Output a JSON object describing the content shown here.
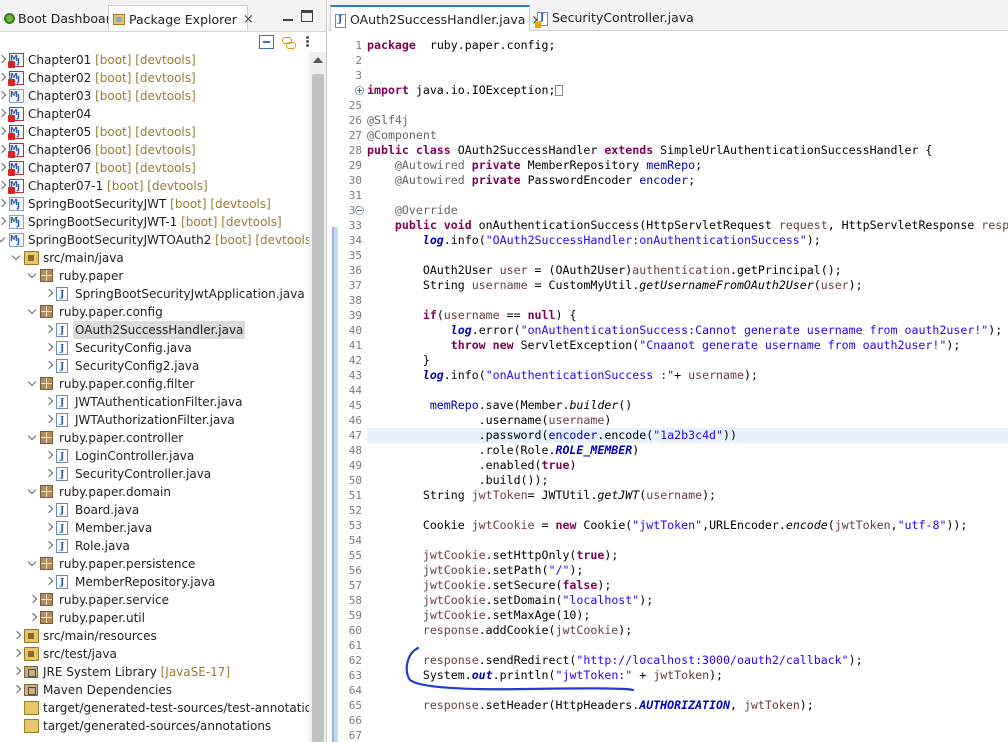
{
  "left_tabs": {
    "boot_dashboard": "Boot Dashboard",
    "package_explorer": "Package Explorer",
    "close": "×"
  },
  "tree": [
    {
      "level": 0,
      "twisty": "closed",
      "icon": "proj",
      "error": true,
      "name": "Chapter01",
      "tag": "[boot] [devtools]"
    },
    {
      "level": 0,
      "twisty": "closed",
      "icon": "proj",
      "error": true,
      "name": "Chapter02",
      "tag": "[boot] [devtools]"
    },
    {
      "level": 0,
      "twisty": "closed",
      "icon": "proj",
      "error": false,
      "name": "Chapter03",
      "tag": "[boot] [devtools]"
    },
    {
      "level": 0,
      "twisty": "closed",
      "icon": "proj",
      "error": true,
      "name": "Chapter04",
      "tag": ""
    },
    {
      "level": 0,
      "twisty": "closed",
      "icon": "proj",
      "error": true,
      "name": "Chapter05",
      "tag": "[boot] [devtools]"
    },
    {
      "level": 0,
      "twisty": "closed",
      "icon": "proj",
      "error": true,
      "name": "Chapter06",
      "tag": "[boot] [devtools]"
    },
    {
      "level": 0,
      "twisty": "closed",
      "icon": "proj",
      "error": true,
      "name": "Chapter07",
      "tag": "[boot] [devtools]"
    },
    {
      "level": 0,
      "twisty": "closed",
      "icon": "proj",
      "error": true,
      "name": "Chapter07-1",
      "tag": "[boot] [devtools]"
    },
    {
      "level": 0,
      "twisty": "closed",
      "icon": "proj",
      "error": false,
      "name": "SpringBootSecurityJWT",
      "tag": "[boot] [devtools]"
    },
    {
      "level": 0,
      "twisty": "closed",
      "icon": "proj",
      "error": false,
      "name": "SpringBootSecurityJWT-1",
      "tag": "[boot] [devtools]"
    },
    {
      "level": 0,
      "twisty": "open",
      "icon": "proj",
      "error": false,
      "name": "SpringBootSecurityJWTOAuth2",
      "tag": "[boot] [devtools]"
    },
    {
      "level": 1,
      "twisty": "open",
      "icon": "srcfolder",
      "name": "src/main/java",
      "tag": ""
    },
    {
      "level": 2,
      "twisty": "open",
      "icon": "pkg",
      "name": "ruby.paper",
      "tag": ""
    },
    {
      "level": 3,
      "twisty": "closed",
      "icon": "java",
      "name": "SpringBootSecurityJwtApplication.java",
      "tag": ""
    },
    {
      "level": 2,
      "twisty": "open",
      "icon": "pkg",
      "name": "ruby.paper.config",
      "tag": ""
    },
    {
      "level": 3,
      "twisty": "closed",
      "icon": "java",
      "name": "OAuth2SuccessHandler.java",
      "tag": "",
      "selected": true
    },
    {
      "level": 3,
      "twisty": "closed",
      "icon": "java",
      "name": "SecurityConfig.java",
      "tag": ""
    },
    {
      "level": 3,
      "twisty": "closed",
      "icon": "java",
      "name": "SecurityConfig2.java",
      "tag": ""
    },
    {
      "level": 2,
      "twisty": "open",
      "icon": "pkg",
      "name": "ruby.paper.config.filter",
      "tag": ""
    },
    {
      "level": 3,
      "twisty": "closed",
      "icon": "java",
      "name": "JWTAuthenticationFilter.java",
      "tag": ""
    },
    {
      "level": 3,
      "twisty": "closed",
      "icon": "java",
      "name": "JWTAuthorizationFilter.java",
      "tag": ""
    },
    {
      "level": 2,
      "twisty": "open",
      "icon": "pkg",
      "name": "ruby.paper.controller",
      "tag": ""
    },
    {
      "level": 3,
      "twisty": "closed",
      "icon": "java",
      "name": "LoginController.java",
      "tag": ""
    },
    {
      "level": 3,
      "twisty": "closed",
      "icon": "java",
      "name": "SecurityController.java",
      "tag": ""
    },
    {
      "level": 2,
      "twisty": "open",
      "icon": "pkg",
      "name": "ruby.paper.domain",
      "tag": ""
    },
    {
      "level": 3,
      "twisty": "closed",
      "icon": "java",
      "name": "Board.java",
      "tag": ""
    },
    {
      "level": 3,
      "twisty": "closed",
      "icon": "java",
      "name": "Member.java",
      "tag": ""
    },
    {
      "level": 3,
      "twisty": "closed",
      "icon": "java",
      "name": "Role.java",
      "tag": ""
    },
    {
      "level": 2,
      "twisty": "open",
      "icon": "pkg",
      "name": "ruby.paper.persistence",
      "tag": ""
    },
    {
      "level": 3,
      "twisty": "closed",
      "icon": "java",
      "name": "MemberRepository.java",
      "tag": ""
    },
    {
      "level": 2,
      "twisty": "closed",
      "icon": "pkg",
      "name": "ruby.paper.service",
      "tag": ""
    },
    {
      "level": 2,
      "twisty": "closed",
      "icon": "pkg",
      "name": "ruby.paper.util",
      "tag": ""
    },
    {
      "level": 1,
      "twisty": "closed",
      "icon": "srcfolder",
      "name": "src/main/resources",
      "tag": ""
    },
    {
      "level": 1,
      "twisty": "closed",
      "icon": "srcfolder",
      "name": "src/test/java",
      "tag": ""
    },
    {
      "level": 1,
      "twisty": "closed",
      "icon": "lib",
      "name": "JRE System Library",
      "tag": "[JavaSE-17]"
    },
    {
      "level": 1,
      "twisty": "closed",
      "icon": "lib",
      "name": "Maven Dependencies",
      "tag": ""
    },
    {
      "level": 1,
      "twisty": "none",
      "icon": "folder",
      "name": "target/generated-test-sources/test-annotations",
      "tag": ""
    },
    {
      "level": 1,
      "twisty": "none",
      "icon": "folder",
      "name": "target/generated-sources/annotations",
      "tag": ""
    }
  ],
  "editor_tabs": {
    "active": "OAuth2SuccessHandler.java",
    "other": "SecurityController.java",
    "close": "×"
  },
  "line_numbers": [
    "1",
    "2",
    "3",
    "4",
    "25",
    "26",
    "27",
    "28",
    "29",
    "30",
    "31",
    "32",
    "33",
    "34",
    "35",
    "36",
    "37",
    "38",
    "39",
    "40",
    "41",
    "42",
    "43",
    "44",
    "45",
    "46",
    "47",
    "48",
    "49",
    "50",
    "51",
    "52",
    "53",
    "54",
    "55",
    "56",
    "57",
    "58",
    "59",
    "60",
    "61",
    "62",
    "63",
    "64",
    "65",
    "66",
    "67"
  ],
  "code_lines": [
    [
      [
        "kw",
        "package"
      ],
      [
        "",
        "  ruby.paper.config;"
      ]
    ],
    [],
    [],
    [
      [
        "kw",
        "import"
      ],
      [
        "",
        " java.io.IOException;"
      ],
      [
        "box",
        ""
      ]
    ],
    [],
    [
      [
        "an",
        "@Slf4j"
      ]
    ],
    [
      [
        "an",
        "@Component"
      ]
    ],
    [
      [
        "kw",
        "public class"
      ],
      [
        "",
        " OAuth2SuccessHandler "
      ],
      [
        "kw",
        "extends"
      ],
      [
        "",
        " SimpleUrlAuthenticationSuccessHandler {"
      ]
    ],
    [
      [
        "",
        "    "
      ],
      [
        "an",
        "@Autowired"
      ],
      [
        "",
        " "
      ],
      [
        "kw",
        "private"
      ],
      [
        "",
        " MemberRepository "
      ],
      [
        "fl",
        "memRepo"
      ],
      [
        "",
        ";"
      ]
    ],
    [
      [
        "",
        "    "
      ],
      [
        "an",
        "@Autowired"
      ],
      [
        "",
        " "
      ],
      [
        "kw",
        "private"
      ],
      [
        "",
        " PasswordEncoder "
      ],
      [
        "fl",
        "encoder"
      ],
      [
        "",
        ";"
      ]
    ],
    [],
    [
      [
        "",
        "    "
      ],
      [
        "an",
        "@Override"
      ]
    ],
    [
      [
        "",
        "    "
      ],
      [
        "kw",
        "public void"
      ],
      [
        "",
        " onAuthenticationSuccess(HttpServletRequest "
      ],
      [
        "lv",
        "request"
      ],
      [
        "",
        ", HttpServletResponse "
      ],
      [
        "lv",
        "resp"
      ]
    ],
    [
      [
        "",
        "        "
      ],
      [
        "fi",
        "log"
      ],
      [
        "",
        ".info("
      ],
      [
        "st",
        "\"OAuth2SuccessHandler:onAuthenticationSuccess\""
      ],
      [
        "",
        ");"
      ]
    ],
    [],
    [
      [
        "",
        "        OAuth2User "
      ],
      [
        "lv",
        "user"
      ],
      [
        "",
        " = (OAuth2User)"
      ],
      [
        "lv",
        "authentication"
      ],
      [
        "",
        ".getPrincipal();"
      ]
    ],
    [
      [
        "",
        "        String "
      ],
      [
        "lv",
        "username"
      ],
      [
        "",
        " = CustomMyUtil."
      ],
      [
        "it",
        "getUsernameFromOAuth2User"
      ],
      [
        "",
        "("
      ],
      [
        "lv",
        "user"
      ],
      [
        "",
        ");"
      ]
    ],
    [],
    [
      [
        "",
        "        "
      ],
      [
        "kw",
        "if"
      ],
      [
        "",
        "("
      ],
      [
        "lv",
        "username"
      ],
      [
        "",
        " == "
      ],
      [
        "kw",
        "null"
      ],
      [
        "",
        ") {"
      ]
    ],
    [
      [
        "",
        "            "
      ],
      [
        "fi",
        "log"
      ],
      [
        "",
        ".error("
      ],
      [
        "st",
        "\"onAuthenticationSuccess:Cannot generate username from oauth2user!\""
      ],
      [
        "",
        ");"
      ]
    ],
    [
      [
        "",
        "            "
      ],
      [
        "kw",
        "throw new"
      ],
      [
        "",
        " ServletException("
      ],
      [
        "st",
        "\"Cnaanot generate username from oauth2user!\""
      ],
      [
        "",
        ");"
      ]
    ],
    [
      [
        "",
        "        }"
      ]
    ],
    [
      [
        "",
        "        "
      ],
      [
        "fi",
        "log"
      ],
      [
        "",
        ".info("
      ],
      [
        "st",
        "\"onAuthenticationSuccess :\""
      ],
      [
        "",
        "+ "
      ],
      [
        "lv",
        "username"
      ],
      [
        "",
        ");"
      ]
    ],
    [],
    [
      [
        "",
        "         "
      ],
      [
        "fl",
        "memRepo"
      ],
      [
        "",
        ".save(Member."
      ],
      [
        "it",
        "builder"
      ],
      [
        "",
        "()"
      ]
    ],
    [
      [
        "",
        "                .username("
      ],
      [
        "lv",
        "username"
      ],
      [
        "",
        ")"
      ]
    ],
    [
      [
        "",
        "                .password("
      ],
      [
        "fl",
        "encoder"
      ],
      [
        "",
        ".encode("
      ],
      [
        "st",
        "\"1a2b3c4d\""
      ],
      [
        "",
        "))"
      ]
    ],
    [
      [
        "",
        "                .role(Role."
      ],
      [
        "fi",
        "ROLE_MEMBER"
      ],
      [
        "",
        ")"
      ]
    ],
    [
      [
        "",
        "                .enabled("
      ],
      [
        "kw",
        "true"
      ],
      [
        "",
        ")"
      ]
    ],
    [
      [
        "",
        "                .build());"
      ]
    ],
    [
      [
        "",
        "        String "
      ],
      [
        "lv",
        "jwtToken"
      ],
      [
        "",
        "= JWTUtil."
      ],
      [
        "it",
        "getJWT"
      ],
      [
        "",
        "("
      ],
      [
        "lv",
        "username"
      ],
      [
        "",
        ");"
      ]
    ],
    [],
    [
      [
        "",
        "        Cookie "
      ],
      [
        "lv",
        "jwtCookie"
      ],
      [
        "",
        " = "
      ],
      [
        "kw",
        "new"
      ],
      [
        "",
        " Cookie("
      ],
      [
        "st",
        "\"jwtToken\""
      ],
      [
        "",
        ",URLEncoder."
      ],
      [
        "it",
        "encode"
      ],
      [
        "",
        "("
      ],
      [
        "lv",
        "jwtToken"
      ],
      [
        "",
        ","
      ],
      [
        "st",
        "\"utf-8\""
      ],
      [
        "",
        "));"
      ]
    ],
    [],
    [
      [
        "",
        "        "
      ],
      [
        "lv",
        "jwtCookie"
      ],
      [
        "",
        ".setHttpOnly("
      ],
      [
        "kw",
        "true"
      ],
      [
        "",
        ");"
      ]
    ],
    [
      [
        "",
        "        "
      ],
      [
        "lv",
        "jwtCookie"
      ],
      [
        "",
        ".setPath("
      ],
      [
        "st",
        "\"/\""
      ],
      [
        "",
        ");"
      ]
    ],
    [
      [
        "",
        "        "
      ],
      [
        "lv",
        "jwtCookie"
      ],
      [
        "",
        ".setSecure("
      ],
      [
        "kw",
        "false"
      ],
      [
        "",
        ");"
      ]
    ],
    [
      [
        "",
        "        "
      ],
      [
        "lv",
        "jwtCookie"
      ],
      [
        "",
        ".setDomain("
      ],
      [
        "st",
        "\"localhost\""
      ],
      [
        "",
        ");"
      ]
    ],
    [
      [
        "",
        "        "
      ],
      [
        "lv",
        "jwtCookie"
      ],
      [
        "",
        ".setMaxAge(10);"
      ]
    ],
    [
      [
        "",
        "        "
      ],
      [
        "lv",
        "response"
      ],
      [
        "",
        ".addCookie("
      ],
      [
        "lv",
        "jwtCookie"
      ],
      [
        "",
        ");"
      ]
    ],
    [],
    [
      [
        "",
        "        "
      ],
      [
        "lv",
        "response"
      ],
      [
        "",
        ".sendRedirect("
      ],
      [
        "st",
        "\"http://localhost:3000/oauth2/callback\""
      ],
      [
        "",
        ");"
      ]
    ],
    [
      [
        "",
        "        System."
      ],
      [
        "fi",
        "out"
      ],
      [
        "",
        ".println("
      ],
      [
        "st",
        "\"jwtToken:\""
      ],
      [
        "",
        " + "
      ],
      [
        "lv",
        "jwtToken"
      ],
      [
        "",
        ");"
      ]
    ],
    [],
    [
      [
        "",
        "        "
      ],
      [
        "lv",
        "response"
      ],
      [
        "",
        ".setHeader(HttpHeaders."
      ],
      [
        "fi",
        "AUTHORIZATION"
      ],
      [
        "",
        ", "
      ],
      [
        "lv",
        "jwtToken"
      ],
      [
        "",
        ");"
      ]
    ],
    [],
    []
  ],
  "colors": {
    "keyword": "#7f0055",
    "string": "#2a00ff",
    "field": "#0000c0",
    "annotation": "#646464",
    "current_line": "#e8f2fe",
    "pen": "#1f3fd0"
  }
}
